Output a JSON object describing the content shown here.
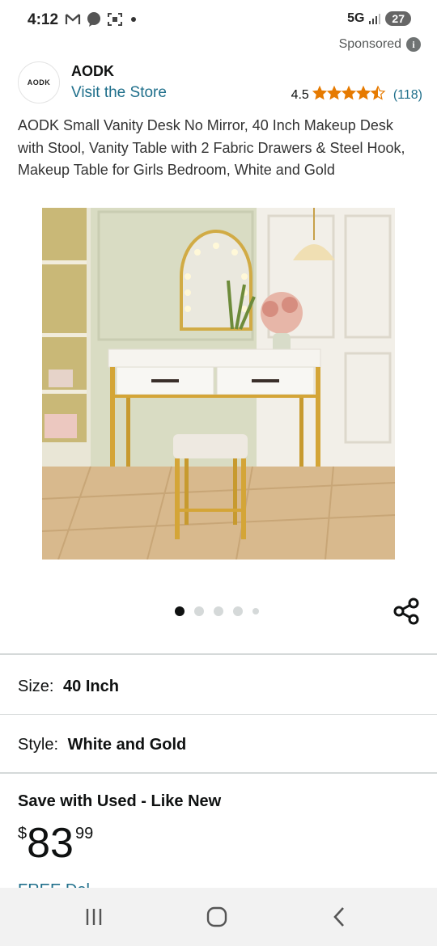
{
  "status_bar": {
    "time": "4:12",
    "network": "5G",
    "battery": "27",
    "icons": [
      "gmail-icon",
      "talk-icon",
      "screenshot-icon",
      "dot-icon"
    ]
  },
  "sponsored_label": "Sponsored",
  "brand": {
    "logo_text": "AODK",
    "name": "AODK",
    "visit_store": "Visit the Store"
  },
  "rating": {
    "value": "4.5",
    "stars": 4.5,
    "count": "(118)"
  },
  "product": {
    "title": "AODK Small Vanity Desk No Mirror, 40 Inch Makeup Desk with Stool, Vanity Table with 2 Fabric Drawers & Steel Hook, Makeup Table for Girls Bedroom, White and Gold",
    "image_alt": "Vanity desk with stool in a bedroom",
    "carousel": {
      "total": 5,
      "active": 0
    }
  },
  "options": {
    "size_label": "Size:",
    "size_value": "40 Inch",
    "style_label": "Style:",
    "style_value": "White and Gold"
  },
  "offer": {
    "heading": "Save with Used - Like New",
    "currency": "$",
    "price_whole": "83",
    "price_fraction": "99",
    "free_delivery_partial": "FREE Del"
  },
  "colors": {
    "link": "#1f6f8b",
    "star": "#e67a00",
    "text": "#0f1111",
    "divider": "#d5d9d9"
  }
}
